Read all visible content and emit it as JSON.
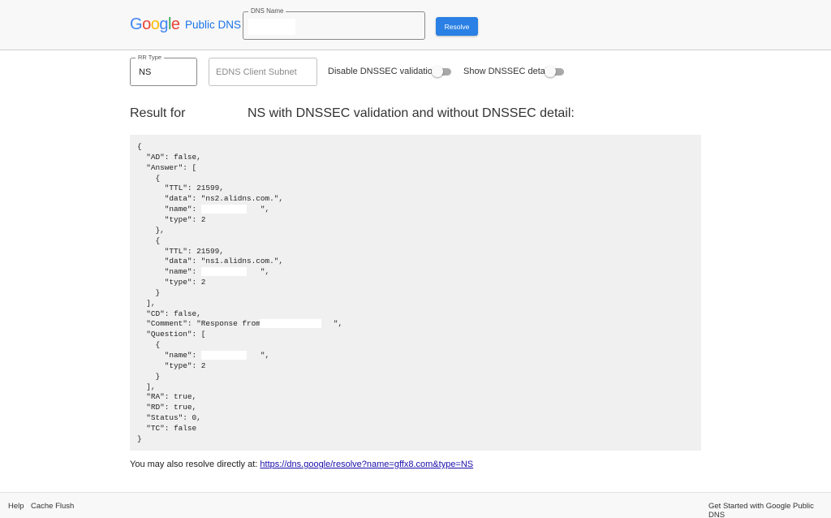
{
  "header": {
    "logo": "Google",
    "product": "Public DNS",
    "dns_name_label": "DNS Name",
    "dns_name_value": "",
    "resolve_label": "Resolve"
  },
  "controls": {
    "rr_type_label": "RR Type",
    "rr_type_value": "NS",
    "edns_placeholder": "EDNS Client Subnet",
    "disable_dnssec_label": "Disable DNSSEC validation",
    "disable_dnssec_on": false,
    "show_dnssec_label": "Show DNSSEC detail",
    "show_dnssec_on": false
  },
  "result": {
    "title_prefix": "Result for",
    "title_suffix": "NS with DNSSEC validation and without DNSSEC detail:"
  },
  "json_lines": [
    "{",
    "  \"AD\": false,",
    "  \"Answer\": [",
    "    {",
    "      \"TTL\": 21599,",
    "      \"data\": \"ns2.alidns.com.\",",
    "      \"name\": \"            \",",
    "      \"type\": 2",
    "    },",
    "    {",
    "      \"TTL\": 21599,",
    "      \"data\": \"ns1.alidns.com.\",",
    "      \"name\": \"            \",",
    "      \"type\": 2",
    "    }",
    "  ],",
    "  \"CD\": false,",
    "  \"Comment\": \"Response from                \",",
    "  \"Question\": [",
    "    {",
    "      \"name\": \"            \",",
    "      \"type\": 2",
    "    }",
    "  ],",
    "  \"RA\": true,",
    "  \"RD\": true,",
    "  \"Status\": 0,",
    "  \"TC\": false",
    "}"
  ],
  "direct": {
    "prefix": "You may also resolve directly at: ",
    "link_text": "https://dns.google/resolve?name=gffx8.com&type=NS"
  },
  "footer": {
    "help": "Help",
    "cache_flush": "Cache Flush",
    "get_started": "Get Started with Google Public DNS"
  },
  "colors": {
    "accent": "#2a80e4",
    "link": "#1a0dab"
  }
}
